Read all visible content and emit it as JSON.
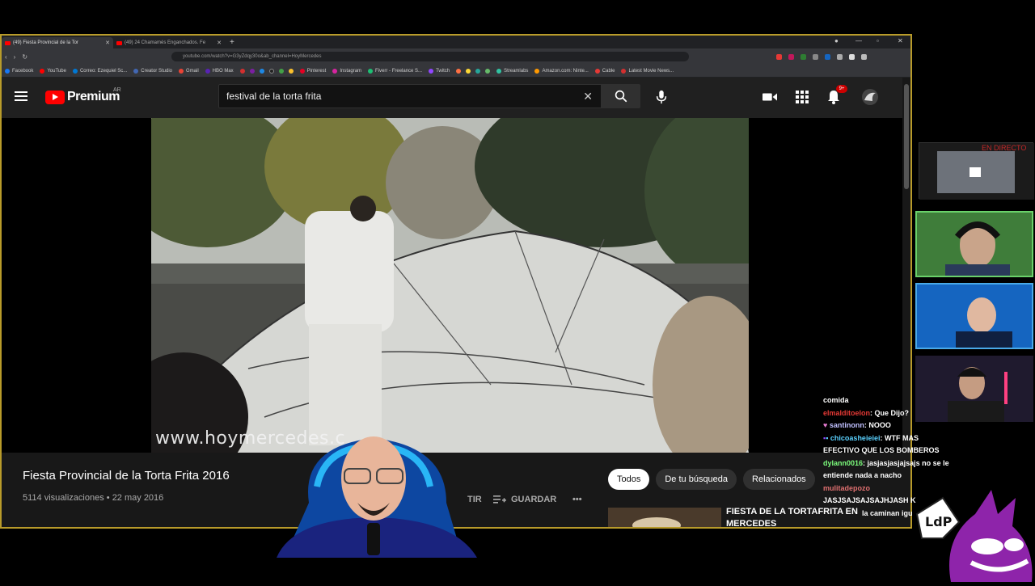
{
  "browser": {
    "tabs": [
      {
        "label": "(49) Fiesta Provincial de la Tor",
        "active": true
      },
      {
        "label": "(49) 24 Chamamés Enganchados. Fe",
        "active": false
      }
    ],
    "url": "youtube.com/watch?v=G3yZdqy30o&ab_channel=HoyMercedes",
    "bookmarks": [
      {
        "label": "Facebook",
        "color": "#1877f2"
      },
      {
        "label": "YouTube",
        "color": "#ff0000"
      },
      {
        "label": "Correo: Ezequiel Sc...",
        "color": "#0078d4"
      },
      {
        "label": "Creator Studio",
        "color": "#4267b2"
      },
      {
        "label": "Gmail",
        "color": "#ea4335"
      },
      {
        "label": "HBO Max",
        "color": "#5822b4"
      },
      {
        "label": "Pinterest",
        "color": "#e60023"
      },
      {
        "label": "Instagram",
        "color": "#d6249f"
      },
      {
        "label": "Fiverr - Freelance S...",
        "color": "#1dbf73"
      },
      {
        "label": "Twitch",
        "color": "#9146ff"
      },
      {
        "label": "Streamlabs",
        "color": "#31c3a2"
      },
      {
        "label": "Amazon.com: Ninte...",
        "color": "#ff9900"
      },
      {
        "label": "Cable",
        "color": "#e53935"
      },
      {
        "label": "Latest Movie News...",
        "color": "#d32f2f"
      }
    ]
  },
  "youtube": {
    "logo_word": "Premium",
    "region": "AR",
    "search_value": "festival de la  torta frita",
    "notification_count": "9+",
    "video": {
      "title": "Fiesta Provincial de la Torta Frita 2016",
      "views": "5114 visualizaciones",
      "date": "22 may 2016",
      "watermark": "www.hoymercedes.c",
      "save_label": "GUARDAR",
      "share_label": "TIR"
    },
    "chips": [
      "Todos",
      "De tu búsqueda",
      "Relacionados"
    ],
    "related_title": "FIESTA DE LA TORTAFRITA EN MERCEDES"
  },
  "overlay": {
    "live_label": "EN DIRECTO",
    "chat": [
      {
        "user": "",
        "text": "comida",
        "color": "#ffffff"
      },
      {
        "user": "elmalditoelon",
        "text": "Que Dijo?",
        "color": "#e53935"
      },
      {
        "user": "santinonn",
        "text": "NOOO",
        "color": "#c0c0ff"
      },
      {
        "user": "chicoasheieiei",
        "text": "WTF MAS EFECTIVO QUE LOS BOMBEROS",
        "color": "#5ad1ff"
      },
      {
        "user": "dylann0016",
        "text": "jasjasjasjajsajs no se le entiende nada a nacho",
        "color": "#7cfc7c"
      },
      {
        "user": "mulitadepozo",
        "text": "JASJSAJSAJSAJHJASH K",
        "color": "#e07070"
      },
      {
        "user": "",
        "text": "la caminan igu",
        "color": "#ffffff"
      }
    ]
  }
}
